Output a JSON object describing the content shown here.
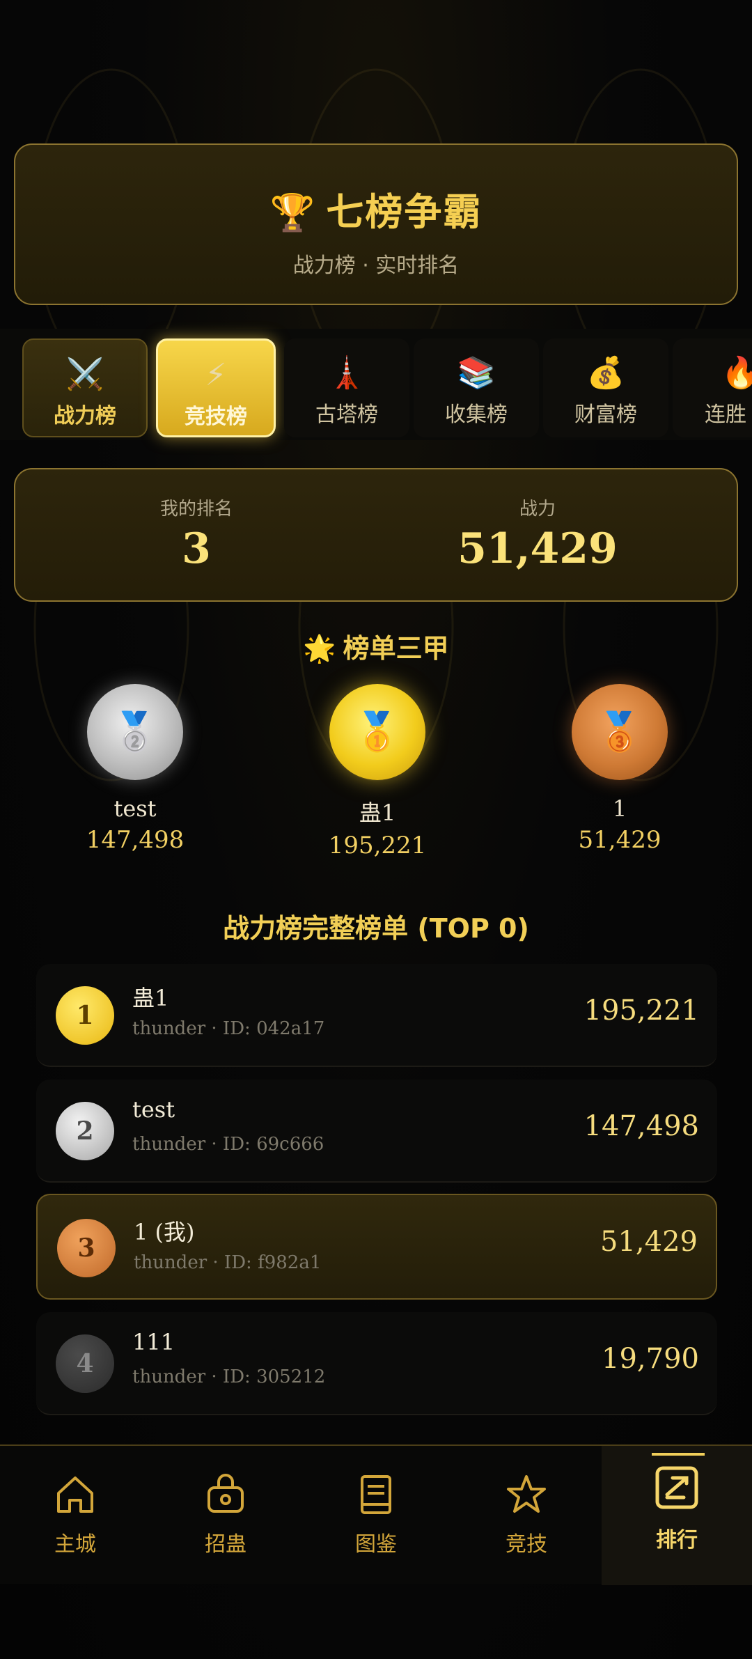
{
  "header": {
    "trophy_icon": "🏆",
    "title": "七榜争霸",
    "subtitle": "战力榜 · 实时排名"
  },
  "tabs": [
    {
      "icon": "⚔️",
      "label": "战力榜",
      "state": "highlighted"
    },
    {
      "icon": "⚡",
      "label": "竞技榜",
      "state": "active"
    },
    {
      "icon": "🗼",
      "label": "古塔榜",
      "state": "normal"
    },
    {
      "icon": "📚",
      "label": "收集榜",
      "state": "normal"
    },
    {
      "icon": "💰",
      "label": "财富榜",
      "state": "normal"
    },
    {
      "icon": "🔥",
      "label": "连胜",
      "state": "normal"
    }
  ],
  "my_rank": {
    "rank_label": "我的排名",
    "rank_value": "3",
    "power_label": "战力",
    "power_value": "51,429"
  },
  "podium": {
    "star_icon": "🌟",
    "title": "榜单三甲",
    "entries": [
      {
        "name": "test",
        "score": "147,498",
        "medal": "silver"
      },
      {
        "name": "蛊1",
        "score": "195,221",
        "medal": "gold"
      },
      {
        "name": "1",
        "score": "51,429",
        "medal": "bronze"
      }
    ]
  },
  "list": {
    "title": "战力榜完整榜单 (TOP 0)",
    "rows": [
      {
        "rank": "1",
        "name": "蛊1",
        "sub": "thunder · ID: 042a17",
        "score": "195,221",
        "is_me": false
      },
      {
        "rank": "2",
        "name": "test",
        "sub": "thunder · ID: 69c666",
        "score": "147,498",
        "is_me": false
      },
      {
        "rank": "3",
        "name": "1 (我)",
        "sub": "thunder · ID: f982a1",
        "score": "51,429",
        "is_me": true
      },
      {
        "rank": "4",
        "name": "111",
        "sub": "thunder · ID: 305212",
        "score": "19,790",
        "is_me": false
      }
    ]
  },
  "nav": {
    "items": [
      {
        "label": "主城",
        "icon": "home-icon"
      },
      {
        "label": "招蛊",
        "icon": "bag-icon"
      },
      {
        "label": "图鉴",
        "icon": "book-icon"
      },
      {
        "label": "竞技",
        "icon": "star-icon"
      },
      {
        "label": "排行",
        "icon": "ranking-icon",
        "active": true
      }
    ]
  },
  "colors": {
    "accent_gold": "#f5cf52",
    "card_border": "#8c7430",
    "background": "#050505"
  }
}
